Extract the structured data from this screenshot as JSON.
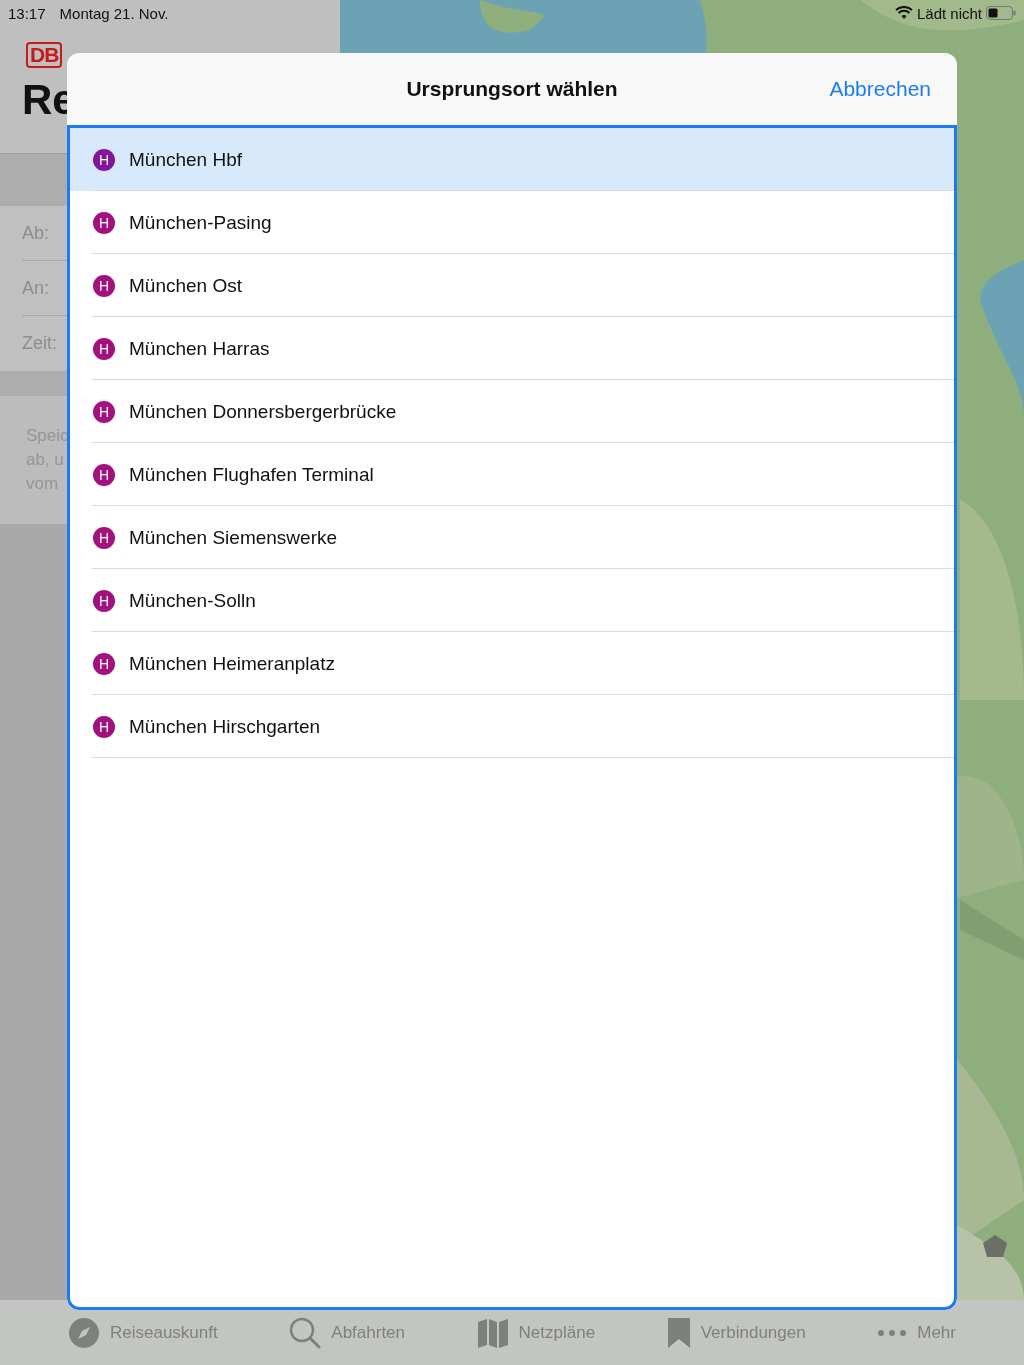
{
  "status_bar": {
    "time": "13:17",
    "date": "Montag 21. Nov.",
    "battery_text": "Lädt nicht"
  },
  "background_app": {
    "logo": "DB",
    "title": "Re",
    "fields": [
      {
        "label": "Ab:"
      },
      {
        "label": "An:"
      },
      {
        "label": "Zeit:"
      }
    ],
    "note_lines": [
      "Speic",
      "ab, u",
      "vom"
    ]
  },
  "sheet": {
    "title": "Ursprungsort wählen",
    "cancel": "Abbrechen",
    "stations": [
      {
        "symbol": "H",
        "name": "München Hbf",
        "selected": true
      },
      {
        "symbol": "H",
        "name": "München-Pasing",
        "selected": false
      },
      {
        "symbol": "H",
        "name": "München Ost",
        "selected": false
      },
      {
        "symbol": "H",
        "name": "München Harras",
        "selected": false
      },
      {
        "symbol": "H",
        "name": "München Donnersbergerbrücke",
        "selected": false
      },
      {
        "symbol": "H",
        "name": "München Flughafen Terminal",
        "selected": false
      },
      {
        "symbol": "H",
        "name": "München Siemenswerke",
        "selected": false
      },
      {
        "symbol": "H",
        "name": "München-Solln",
        "selected": false
      },
      {
        "symbol": "H",
        "name": "München Heimeranplatz",
        "selected": false
      },
      {
        "symbol": "H",
        "name": "München Hirschgarten",
        "selected": false
      }
    ]
  },
  "tab_bar": [
    {
      "kind": "compass",
      "label": "Reiseauskunft"
    },
    {
      "kind": "search",
      "label": "Abfahrten"
    },
    {
      "kind": "map",
      "label": "Netzpläne"
    },
    {
      "kind": "bookmark",
      "label": "Verbindungen"
    },
    {
      "kind": "more",
      "label": "Mehr"
    }
  ]
}
